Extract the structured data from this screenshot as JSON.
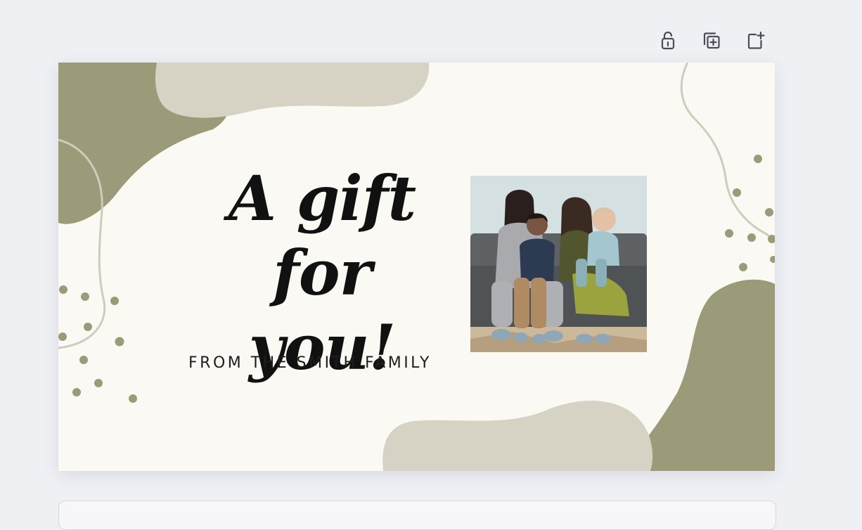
{
  "toolbar": {
    "buttons": [
      {
        "icon": "unlock-icon",
        "label": "Unlock"
      },
      {
        "icon": "duplicate-icon",
        "label": "Duplicate"
      },
      {
        "icon": "add-page-icon",
        "label": "Add page"
      }
    ]
  },
  "card": {
    "headline": "A gift\nfor you!",
    "from_text": "FROM THE SMITH FAMILY",
    "photo_alt": "family photo"
  },
  "colors": {
    "page_bg": "#eff0f4",
    "card_bg": "#fbf9f4",
    "olive": "#9b9b79",
    "sand": "#d6d2c4",
    "line": "#d0cbbd"
  }
}
